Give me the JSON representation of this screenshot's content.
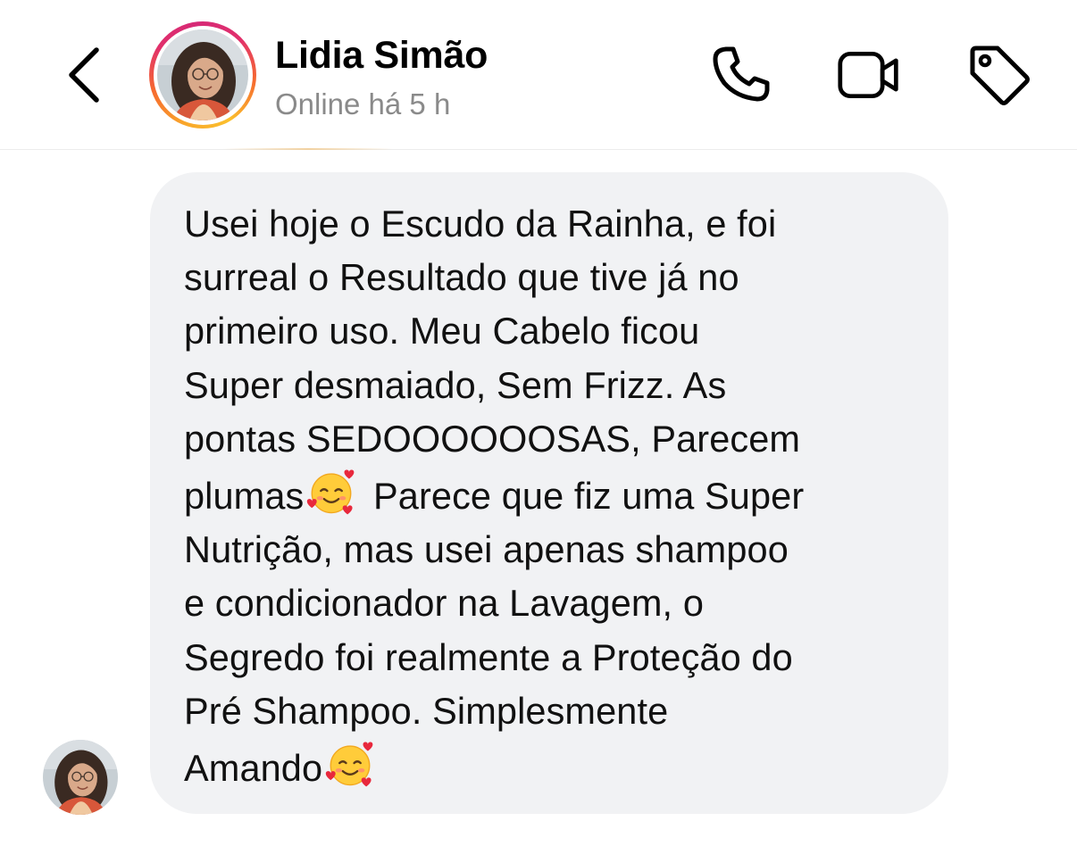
{
  "header": {
    "back_icon": "chevron-left-icon",
    "contact_name": "Lidia Simão",
    "status": "Online há 5 h",
    "actions": [
      {
        "icon": "phone-icon",
        "label": "call"
      },
      {
        "icon": "video-camera-icon",
        "label": "video call"
      },
      {
        "icon": "tag-icon",
        "label": "label"
      }
    ],
    "story_ring_colors": [
      "#f9a72b",
      "#f66b2f",
      "#e1306c",
      "#d62976"
    ]
  },
  "message": {
    "text_part1": "Usei hoje o Escudo da Rainha, e foi\nsurreal o Resultado que tive já no\nprimeiro uso. Meu Cabelo ficou\nSuper desmaiado, Sem Frizz. As\npontas SEDOOOOOOSAS, Parecem\nplumas",
    "text_part2": " Parece que fiz uma Super\nNutrição, mas usei apenas shampoo\ne condicionador na Lavagem, o\nSegredo foi realmente a Proteção do\nPré Shampoo. Simplesmente\nAmando",
    "emoji": "smiling-face-with-hearts",
    "bubble_color": "#f1f2f4"
  }
}
